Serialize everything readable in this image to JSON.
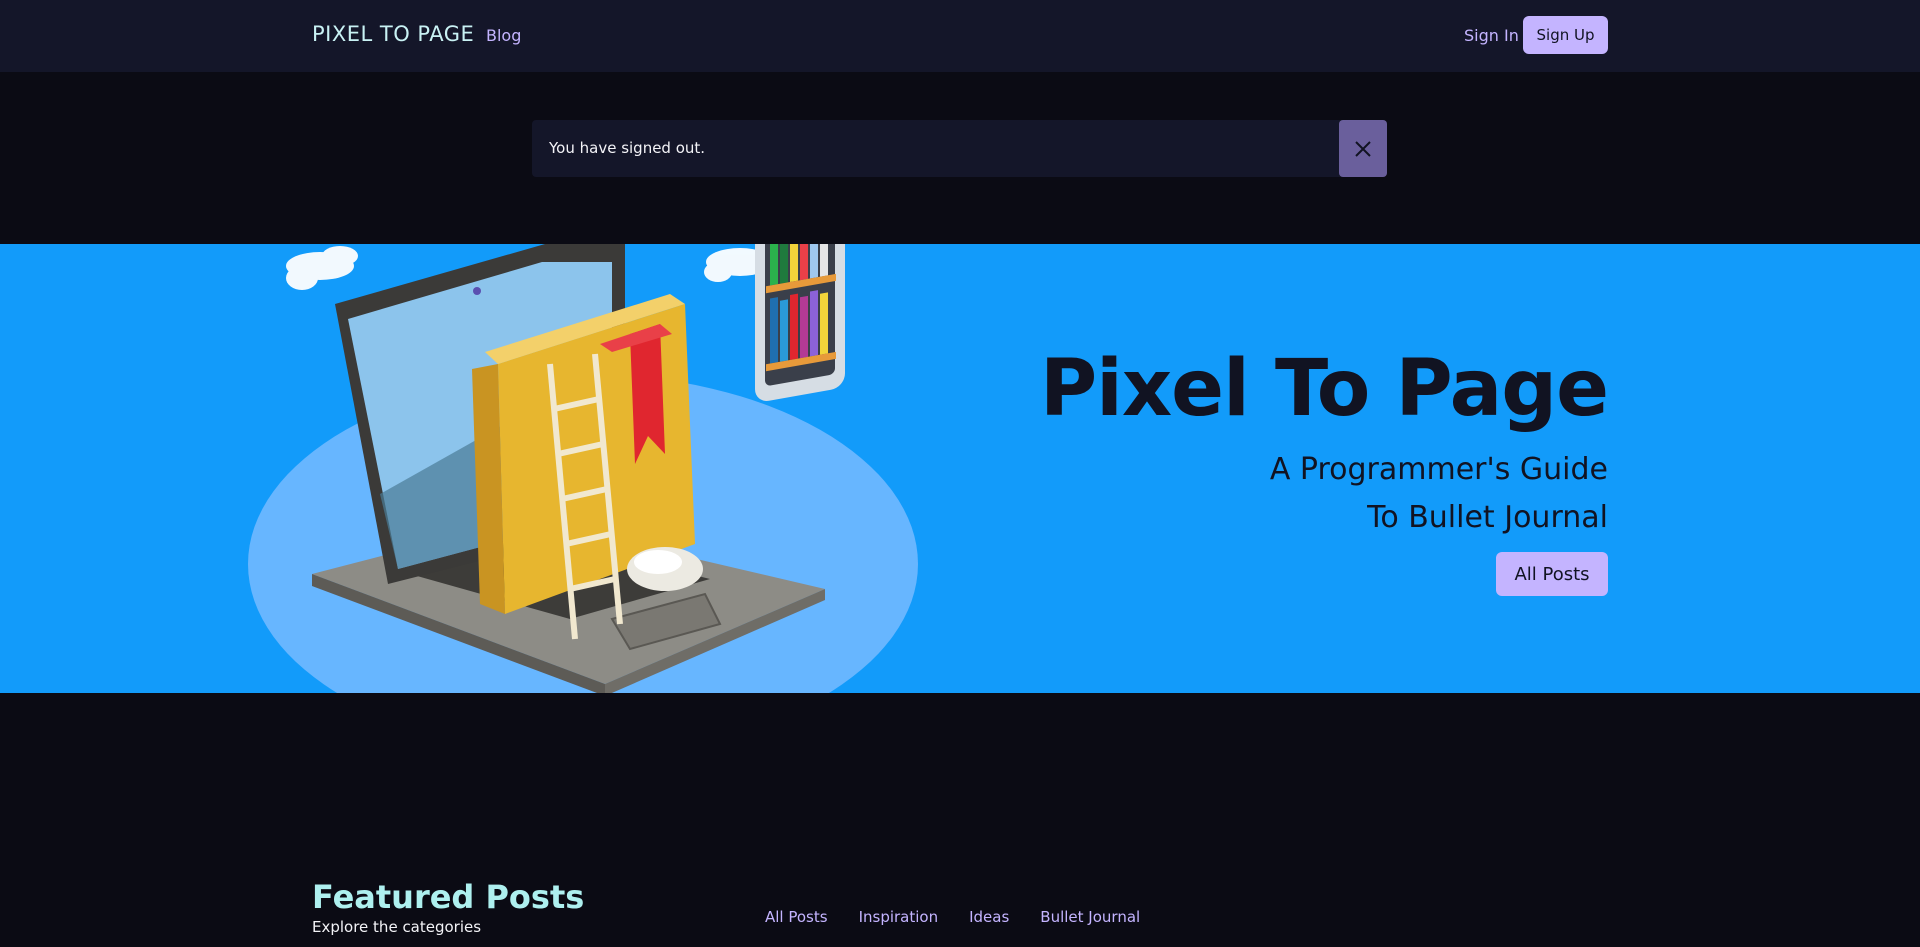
{
  "nav": {
    "brand": "PIXEL TO PAGE",
    "blog": "Blog",
    "sign_in": "Sign In",
    "sign_up": "Sign Up"
  },
  "flash": {
    "message": "You have signed out.",
    "close_icon": "close-icon"
  },
  "hero": {
    "title": "Pixel To Page",
    "subtitle_line1": "A Programmer's Guide",
    "subtitle_line2": "To Bullet Journal",
    "cta": "All Posts",
    "illustration": "laptop-books-illustration"
  },
  "featured": {
    "title": "Featured Posts",
    "subtitle": "Explore the categories",
    "categories": [
      "All Posts",
      "Inspiration",
      "Ideas",
      "Bullet Journal"
    ]
  },
  "colors": {
    "nav_bg": "#141629",
    "page_bg": "#0b0b14",
    "hero_bg": "#129bfa",
    "accent": "#c4b4ff",
    "teal": "#aef0ef",
    "close_bg": "#6a5f9c"
  }
}
